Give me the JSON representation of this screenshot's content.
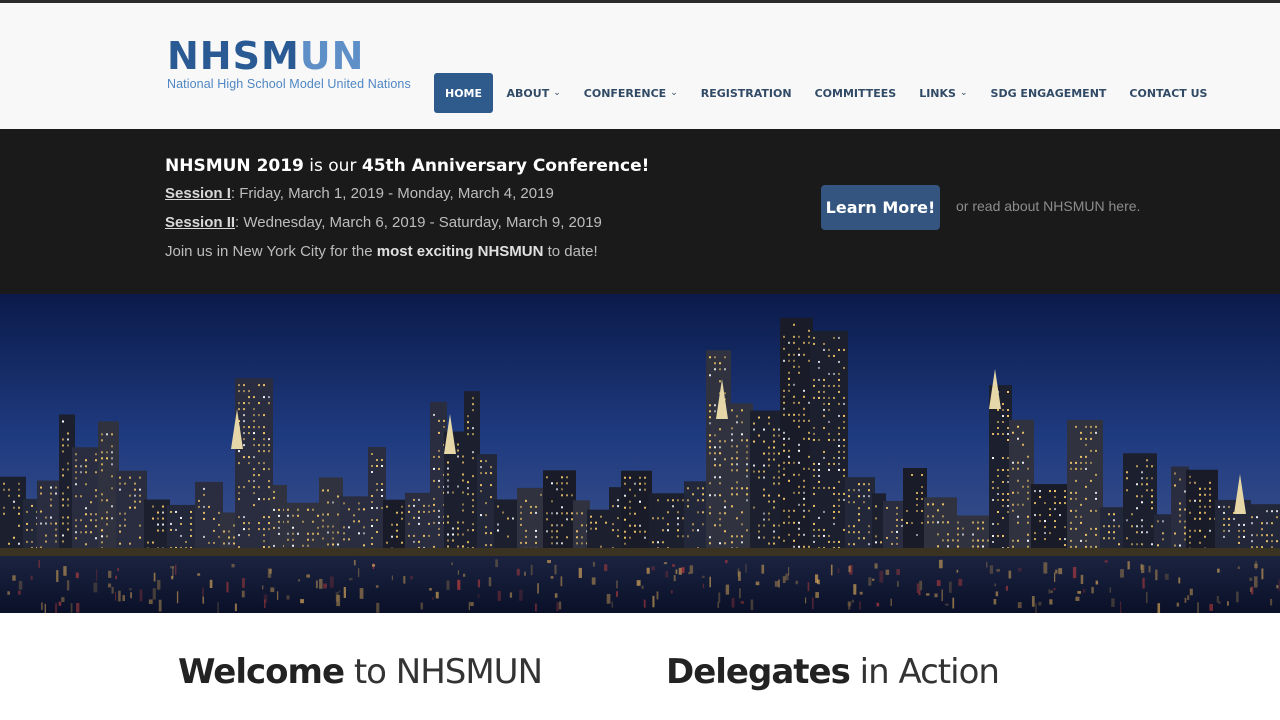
{
  "header": {
    "logo": {
      "main_dark": "NHSM",
      "main_light": "UN",
      "subtitle": "National High School Model United Nations"
    },
    "nav": [
      {
        "label": "HOME",
        "dropdown": false,
        "active": true
      },
      {
        "label": "ABOUT",
        "dropdown": true,
        "active": false
      },
      {
        "label": "CONFERENCE",
        "dropdown": true,
        "active": false
      },
      {
        "label": "REGISTRATION",
        "dropdown": false,
        "active": false
      },
      {
        "label": "COMMITTEES",
        "dropdown": false,
        "active": false
      },
      {
        "label": "LINKS",
        "dropdown": true,
        "active": false
      },
      {
        "label": "SDG ENGAGEMENT",
        "dropdown": false,
        "active": false
      },
      {
        "label": "CONTACT US",
        "dropdown": false,
        "active": false
      }
    ]
  },
  "announcement": {
    "headline_a": "NHSMUN 2019",
    "headline_b": " is our ",
    "headline_c": "45th Anniversary Conference!",
    "session1_label": "Session I",
    "session1_dates": ": Friday, March 1, 2019 - Monday, March 4, 2019",
    "session2_label": "Session II",
    "session2_dates": ": Wednesday, March 6, 2019 - Saturday, March 9, 2019",
    "join_a": "Join us in New York City for the ",
    "join_b": "most exciting NHSMUN",
    "join_c": " to date!",
    "learn_more": "Learn More!",
    "or_read": "or read about NHSMUN here."
  },
  "sections": {
    "welcome_bold": "Welcome",
    "welcome_rest": " to NHSMUN",
    "delegates_bold": "Delegates",
    "delegates_rest": " in Action"
  },
  "colors": {
    "brand": "#2a5a93",
    "nav_active": "#2f5a8c",
    "banner_bg": "#1a1a1a",
    "button": "#33557f"
  }
}
